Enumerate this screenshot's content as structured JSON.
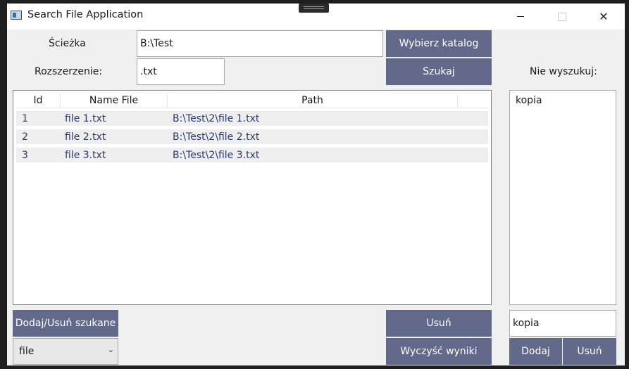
{
  "window": {
    "title": "Search File Application"
  },
  "form": {
    "path_label": "Ścieżka",
    "path_value": "B:\\Test",
    "choose_dir_label": "Wybierz katalog",
    "ext_label": "Rozszerzenie:",
    "ext_value": ".txt",
    "search_label": "Szukaj",
    "exclude_label": "Nie wyszukuj:"
  },
  "results": {
    "columns": [
      "Id",
      "Name File",
      "Path"
    ],
    "rows": [
      {
        "id": "1",
        "name": "file 1.txt",
        "path": "B:\\Test\\2\\file 1.txt"
      },
      {
        "id": "2",
        "name": "file 2.txt",
        "path": "B:\\Test\\2\\file 2.txt"
      },
      {
        "id": "3",
        "name": "file 3.txt",
        "path": "B:\\Test\\2\\file 3.txt"
      }
    ]
  },
  "exclude_list": {
    "items": [
      "kopia"
    ],
    "input_value": "kopia"
  },
  "buttons": {
    "add_remove_searched": "Dodaj/Usuń szukane",
    "remove": "Usuń",
    "clear_results": "Wyczyść wyniki",
    "add": "Dodaj",
    "remove_exclude": "Usuń"
  },
  "mode_select": {
    "selected": "file"
  },
  "colors": {
    "button_bg": "#63698b",
    "row_bg": "#eeeeee",
    "cell_text": "#2a3a6a"
  }
}
